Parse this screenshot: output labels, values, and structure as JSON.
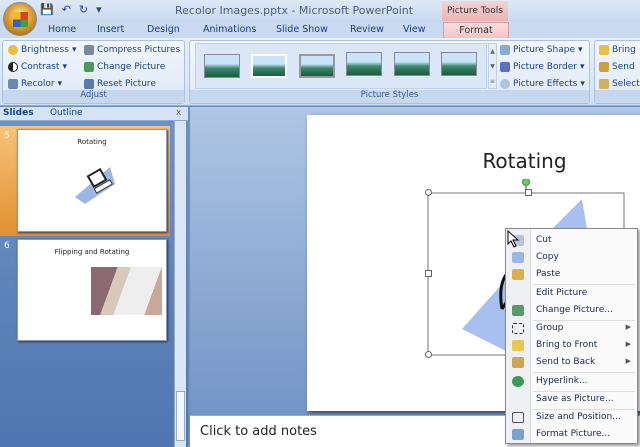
{
  "window": {
    "title": "Recolor Images.pptx - Microsoft PowerPoint",
    "context_tab_group": "Picture Tools"
  },
  "tabs": [
    "Home",
    "Insert",
    "Design",
    "Animations",
    "Slide Show",
    "Review",
    "View",
    "Format"
  ],
  "ribbon": {
    "adjust": {
      "label": "Adjust",
      "items": [
        "Brightness",
        "Compress Pictures",
        "Contrast",
        "Change Picture",
        "Recolor",
        "Reset Picture"
      ]
    },
    "picture_styles": {
      "label": "Picture Styles",
      "items": [
        "Picture Shape",
        "Picture Border",
        "Picture Effects"
      ]
    },
    "arrange": {
      "items": [
        "Bring",
        "Send",
        "Select"
      ]
    }
  },
  "slides_pane": {
    "tabs": [
      "Slides",
      "Outline"
    ],
    "close": "x",
    "slides": [
      {
        "number": "5",
        "title": "Rotating"
      },
      {
        "number": "6",
        "title": "Flipping and Rotating"
      }
    ]
  },
  "slide": {
    "title": "Rotating"
  },
  "notes": {
    "placeholder": "Click to add notes"
  },
  "context_menu": [
    "Cut",
    "Copy",
    "Paste",
    "Edit Picture",
    "Change Picture...",
    "Group",
    "Bring to Front",
    "Send to Back",
    "Hyperlink...",
    "Save as Picture...",
    "Size and Position...",
    "Format Picture..."
  ]
}
